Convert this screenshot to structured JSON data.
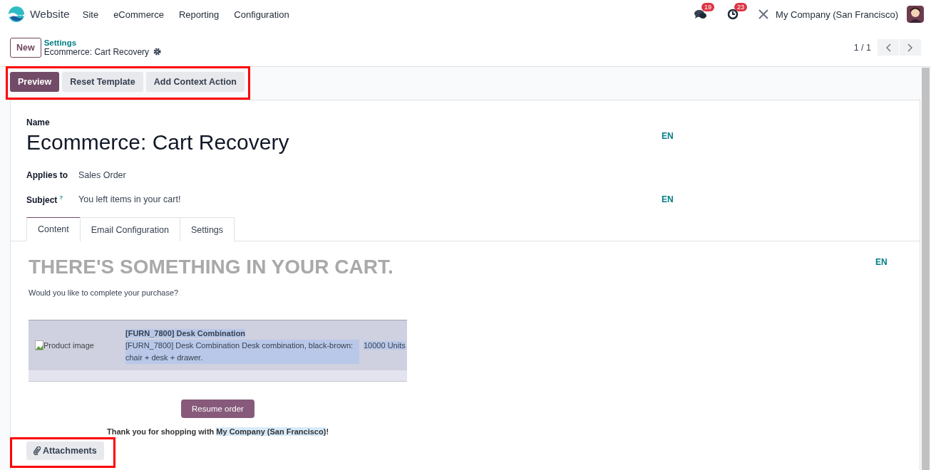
{
  "navbar": {
    "app_name": "Website",
    "menu": [
      "Site",
      "eCommerce",
      "Reporting",
      "Configuration"
    ],
    "messages_badge": "19",
    "activities_badge": "23",
    "company": "My Company (San Francisco)"
  },
  "control_panel": {
    "new_button": "New",
    "breadcrumb": "Settings",
    "record_title": "Ecommerce: Cart Recovery",
    "pager": "1 / 1"
  },
  "actions": {
    "highlighted": true,
    "buttons": [
      {
        "label": "Preview",
        "kind": "primary"
      },
      {
        "label": "Reset Template",
        "kind": "secondary"
      },
      {
        "label": "Add Context Action",
        "kind": "secondary"
      }
    ]
  },
  "form": {
    "name_label": "Name",
    "name": "Ecommerce: Cart Recovery",
    "name_lang": "EN",
    "fields": [
      {
        "label": "Applies to",
        "value": "Sales Order"
      },
      {
        "label": "Subject",
        "help_mark": "?",
        "value": "You left items in your cart!",
        "lang": "EN"
      }
    ],
    "tabs": [
      {
        "label": "Content",
        "selected": true
      },
      {
        "label": "Email Configuration",
        "selected": false
      },
      {
        "label": "Settings",
        "selected": false
      }
    ]
  },
  "content": {
    "lang": "EN",
    "heading": "THERE'S SOMETHING IN YOUR CART.",
    "intro": "Would you like to complete your purchase?",
    "product": {
      "image_alt": "Product image",
      "name": "[FURN_7800] Desk Combination",
      "description": "[FURN_7800] Desk Combination Desk combination, black-brown: chair + desk + drawer.",
      "quantity": "10000 Units"
    },
    "resume_button": "Resume order",
    "thanks": "Thank you for shopping with ",
    "company": "My Company (San Francisco)",
    "thanks_end": "!"
  },
  "attachments": {
    "label": "Attachments",
    "highlighted": true
  }
}
